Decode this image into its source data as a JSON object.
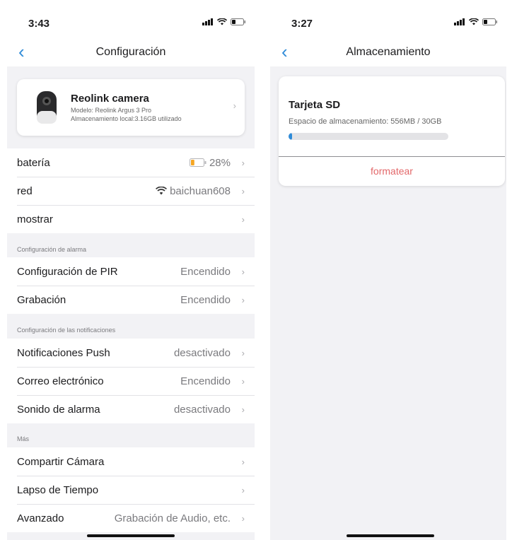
{
  "left": {
    "time": "3:43",
    "nav_title": "Configuración",
    "camera": {
      "name": "Reolink camera",
      "model": "Modelo: Reolink Argus 3 Pro",
      "storage": "Almacenamiento local:3.16GB utilizado"
    },
    "main_rows": [
      {
        "label": "batería",
        "value": "28%",
        "icon": "battery-icon",
        "battery_level": 0.28
      },
      {
        "label": "red",
        "value": "baichuan608",
        "icon": "wifi-icon"
      },
      {
        "label": "mostrar",
        "value": ""
      }
    ],
    "alarm_section": {
      "label": "Configuración de alarma",
      "rows": [
        {
          "label": "Configuración de PIR",
          "value": "Encendido"
        },
        {
          "label": "Grabación",
          "value": "Encendido"
        }
      ]
    },
    "notif_section": {
      "label": "Configuración de las notificaciones",
      "rows": [
        {
          "label": "Notificaciones Push",
          "value": "desactivado"
        },
        {
          "label": "Correo electrónico",
          "value": "Encendido"
        },
        {
          "label": "Sonido de alarma",
          "value": "desactivado"
        }
      ]
    },
    "more_section": {
      "label": "Más",
      "rows": [
        {
          "label": "Compartir Cámara",
          "value": ""
        },
        {
          "label": "Lapso de Tiempo",
          "value": ""
        },
        {
          "label": "Avanzado",
          "value": "Grabación de Audio, etc."
        }
      ]
    }
  },
  "right": {
    "time": "3:27",
    "nav_title": "Almacenamiento",
    "sd": {
      "title": "Tarjeta SD",
      "space": "Espacio de almacenamiento: 556MB / 30GB",
      "used_fraction": 0.02,
      "format_label": "formatear"
    }
  },
  "colors": {
    "accent": "#2f8bd8",
    "danger": "#e3686a",
    "battery": "#f5a623"
  }
}
